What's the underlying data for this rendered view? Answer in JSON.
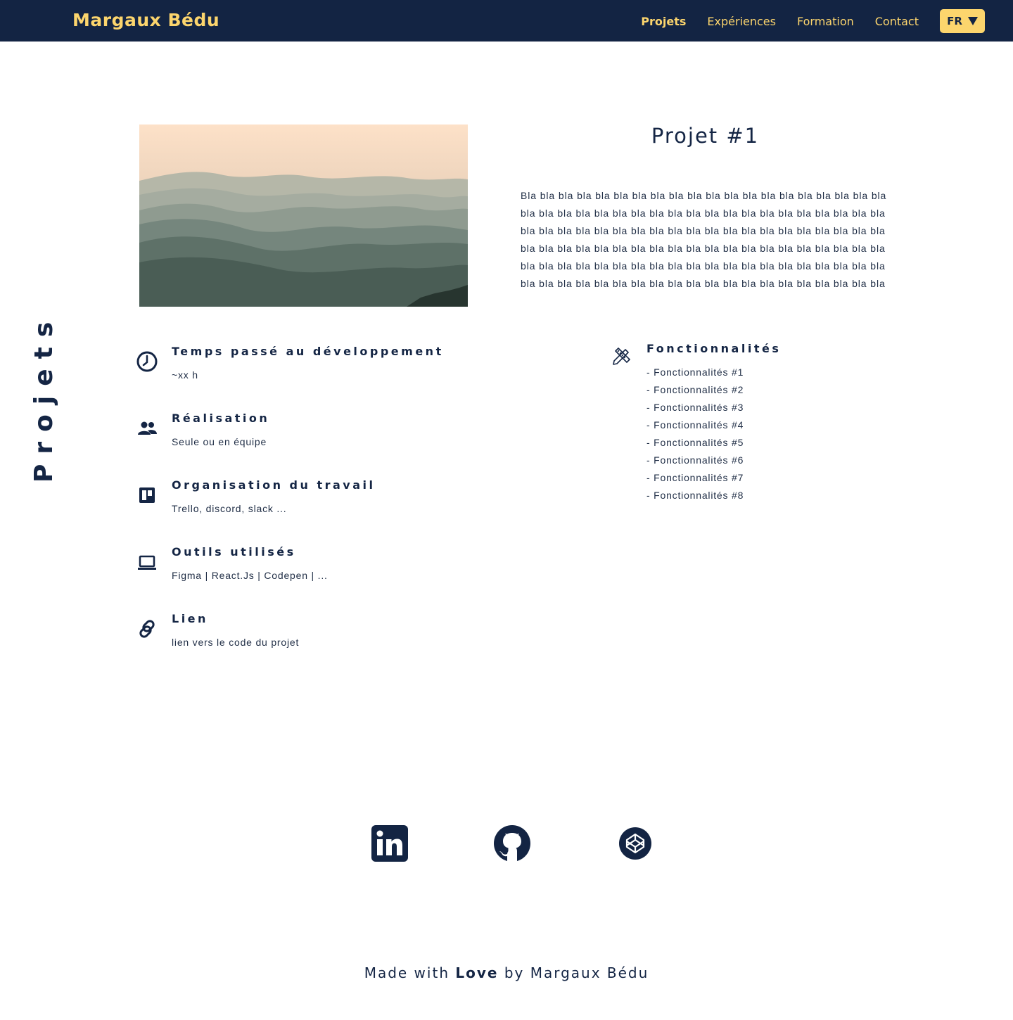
{
  "header": {
    "brand": "Margaux Bédu",
    "nav": [
      "Projets",
      "Expériences",
      "Formation",
      "Contact"
    ],
    "active_nav": "Projets",
    "language": "FR"
  },
  "section_title": "Projets",
  "project": {
    "title": "Projet #1",
    "description": "Bla bla bla bla bla bla bla bla bla bla bla bla bla bla bla bla bla bla bla bla bla bla bla bla bla bla bla bla bla bla bla bla bla bla bla bla bla bla bla bla bla bla bla bla bla bla bla bla bla bla bla bla bla bla bla bla bla bla bla bla bla bla bla bla bla bla bla bla bla bla bla bla bla bla bla bla bla bla bla bla bla bla bla bla bla bla bla bla bla bla bla bla bla bla bla bla bla bla bla bla bla bla bla bla bla bla bla bla bla bla bla bla bla bla bla bla bla bla bla bla",
    "details": [
      {
        "title": "Temps passé au développement",
        "value": "~xx h",
        "icon": "clock-icon"
      },
      {
        "title": "Réalisation",
        "value": "Seule ou en équipe",
        "icon": "people-icon"
      },
      {
        "title": "Organisation du travail",
        "value": "Trello, discord, slack ...",
        "icon": "trello-icon"
      },
      {
        "title": "Outils utilisés",
        "value": "Figma | React.Js | Codepen | ...",
        "icon": "laptop-icon"
      },
      {
        "title": "Lien",
        "value": "lien vers le code du projet",
        "icon": "link-icon"
      }
    ],
    "features": {
      "title": "Fonctionnalités",
      "icon": "pencil-ruler-icon",
      "items": [
        "- Fonctionnalités #1",
        "- Fonctionnalités #2",
        "- Fonctionnalités #3",
        "- Fonctionnalités #4",
        "- Fonctionnalités #5",
        "- Fonctionnalités #6",
        "- Fonctionnalités #7",
        "- Fonctionnalités #8"
      ]
    }
  },
  "social": [
    "linkedin-icon",
    "github-icon",
    "codepen-icon"
  ],
  "footer": {
    "prefix": "Made with",
    "emphasis": "Love",
    "suffix": "by Margaux Bédu"
  },
  "colors": {
    "navy": "#132443",
    "accent": "#fcd56d",
    "text": "#1f2d45"
  }
}
